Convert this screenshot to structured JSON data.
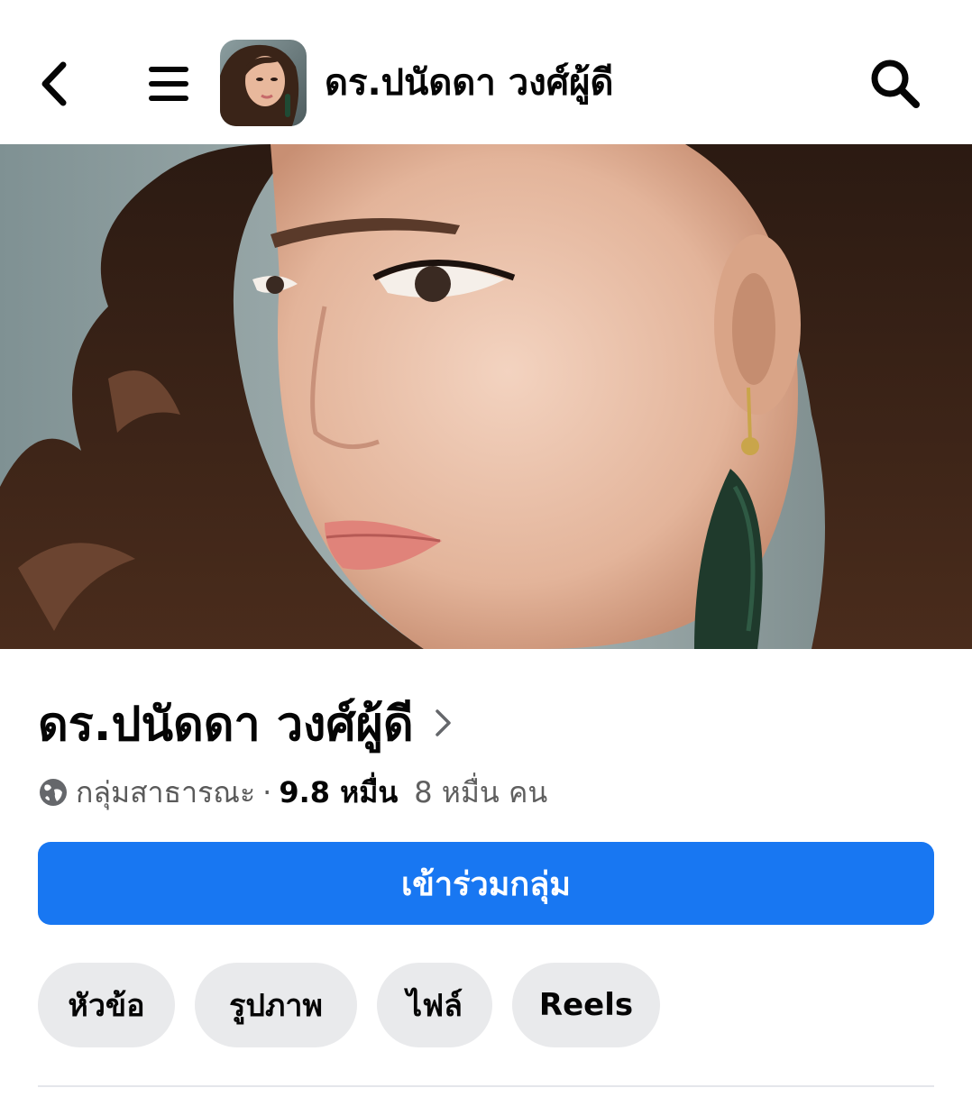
{
  "header": {
    "title": "ดร.ปนัดดา วงศ์ผู้ดี",
    "back_icon": "chevron-left-icon",
    "menu_icon": "hamburger-menu-icon",
    "search_icon": "search-icon"
  },
  "group": {
    "name": "ดร.ปนัดดา วงศ์ผู้ดี",
    "privacy": "กลุ่มสาธารณะ",
    "separator": "·",
    "members": "9.8 หมื่น",
    "members_extra": "8 หมื่น คน"
  },
  "join_button": {
    "label": "เข้าร่วมกลุ่ม"
  },
  "tabs": [
    {
      "label": "หัวข้อ"
    },
    {
      "label": "รูปภาพ"
    },
    {
      "label": "ไฟล์"
    },
    {
      "label": "Reels"
    }
  ],
  "colors": {
    "accent": "#1877f2",
    "tab_bg": "#e9eaec",
    "text": "#050505"
  }
}
